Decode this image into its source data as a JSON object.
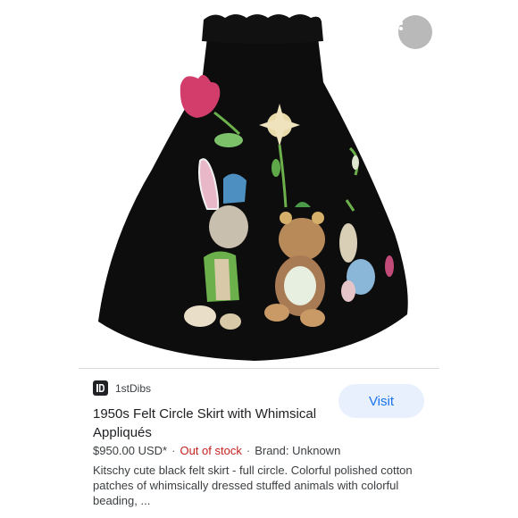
{
  "source": {
    "name": "1stDibs",
    "favicon_icon": "1stdibs-logo-icon"
  },
  "actions": {
    "visit_label": "Visit",
    "more_icon": "more-vert-icon"
  },
  "product": {
    "title": "1950s Felt Circle Skirt with Whimsical Appliqués",
    "price": "$950.00 USD*",
    "stock": "Out of stock",
    "brand": "Brand: Unknown",
    "description": "Kitschy cute black felt skirt - full circle. Colorful polished cotton patches of whimsically dressed stuffed animals with colorful beading, ..."
  },
  "colors": {
    "accent": "#1a73e8",
    "stock": "#c5221f",
    "visit_bg": "#e8f0fe",
    "skirt": "#0d0d0d"
  }
}
